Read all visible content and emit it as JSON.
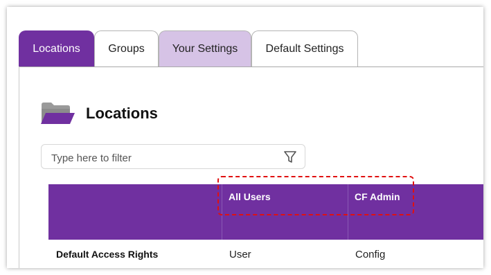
{
  "tabs": [
    {
      "label": "Locations",
      "state": "active"
    },
    {
      "label": "Groups",
      "state": "inactive"
    },
    {
      "label": "Your Settings",
      "state": "highlighted"
    },
    {
      "label": "Default Settings",
      "state": "inactive"
    }
  ],
  "page": {
    "title": "Locations",
    "icon": "folder-icon"
  },
  "filter": {
    "placeholder": "Type here to filter",
    "value": "",
    "icon": "funnel-icon"
  },
  "table": {
    "columns": [
      "",
      "All Users",
      "CF Admin"
    ],
    "rows": [
      {
        "label": "Default Access Rights",
        "values": [
          "User",
          "Config"
        ]
      }
    ]
  },
  "colors": {
    "accent": "#7030a0",
    "tab_highlight": "#d6c3e6",
    "annotation": "#e01010"
  }
}
